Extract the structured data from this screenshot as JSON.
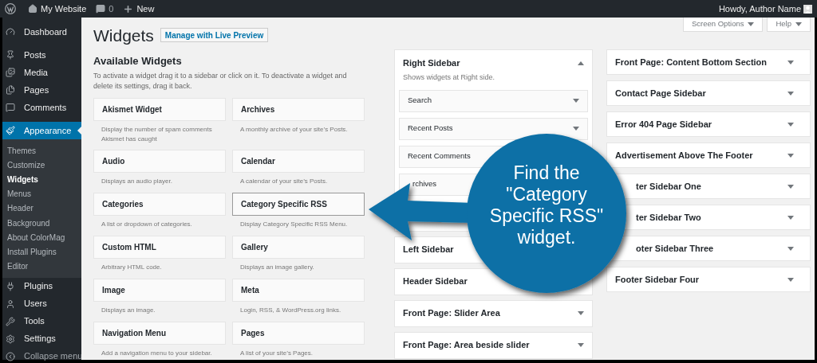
{
  "admin_bar": {
    "site_name": "My Website",
    "comments_count": "0",
    "new_label": "New",
    "greeting": "Howdy, Author Name"
  },
  "admin_menu": [
    {
      "label": "Dashboard",
      "selected": false
    },
    {
      "label": "Posts",
      "selected": false
    },
    {
      "label": "Media",
      "selected": false
    },
    {
      "label": "Pages",
      "selected": false
    },
    {
      "label": "Comments",
      "selected": false
    },
    {
      "label": "Appearance",
      "selected": true,
      "children": [
        {
          "label": "Themes",
          "selected": false
        },
        {
          "label": "Customize",
          "selected": false
        },
        {
          "label": "Widgets",
          "selected": true
        },
        {
          "label": "Menus",
          "selected": false
        },
        {
          "label": "Header",
          "selected": false
        },
        {
          "label": "Background",
          "selected": false
        },
        {
          "label": "About ColorMag",
          "selected": false
        },
        {
          "label": "Install Plugins",
          "selected": false
        },
        {
          "label": "Editor",
          "selected": false
        }
      ]
    },
    {
      "label": "Plugins",
      "selected": false
    },
    {
      "label": "Users",
      "selected": false
    },
    {
      "label": "Tools",
      "selected": false
    },
    {
      "label": "Settings",
      "selected": false
    },
    {
      "label": "Collapse menu",
      "selected": false
    }
  ],
  "page": {
    "title": "Widgets",
    "live_preview_button": "Manage with Live Preview",
    "screen_options": "Screen Options",
    "help": "Help"
  },
  "available_widgets": {
    "heading": "Available Widgets",
    "description": "To activate a widget drag it to a sidebar or click on it. To deactivate a widget and delete its settings, drag it back.",
    "widgets": [
      {
        "name": "Akismet Widget",
        "description": "Display the number of spam comments Akismet has caught",
        "highlighted": false
      },
      {
        "name": "Archives",
        "description": "A monthly archive of your site’s Posts.",
        "highlighted": false
      },
      {
        "name": "Audio",
        "description": "Displays an audio player.",
        "highlighted": false
      },
      {
        "name": "Calendar",
        "description": "A calendar of your site’s Posts.",
        "highlighted": false
      },
      {
        "name": "Categories",
        "description": "A list or dropdown of categories.",
        "highlighted": false
      },
      {
        "name": "Category Specific RSS",
        "description": "Display Category Specific RSS Menu.",
        "highlighted": true
      },
      {
        "name": "Custom HTML",
        "description": "Arbitrary HTML code.",
        "highlighted": false
      },
      {
        "name": "Gallery",
        "description": "Displays an image gallery.",
        "highlighted": false
      },
      {
        "name": "Image",
        "description": "Displays an image.",
        "highlighted": false
      },
      {
        "name": "Meta",
        "description": "Login, RSS, & WordPress.org links.",
        "highlighted": false
      },
      {
        "name": "Navigation Menu",
        "description": "Add a navigation menu to your sidebar.",
        "highlighted": false
      },
      {
        "name": "Pages",
        "description": "A list of your site’s Pages.",
        "highlighted": false
      }
    ]
  },
  "sidebars_middle": [
    {
      "title": "Right Sidebar",
      "expanded": true,
      "description": "Shows widgets at Right side.",
      "widgets": [
        {
          "name": "Search",
          "covered": false
        },
        {
          "name": "Recent Posts",
          "covered": false
        },
        {
          "name": "Recent Comments",
          "covered": false
        },
        {
          "name": "rchives",
          "covered": true
        }
      ]
    },
    {
      "title": "Left Sidebar",
      "expanded": false
    },
    {
      "title": "Header Sidebar",
      "expanded": false
    },
    {
      "title": "Front Page: Slider Area",
      "expanded": false
    },
    {
      "title": "Front Page: Area beside slider",
      "expanded": false
    }
  ],
  "sidebars_right": [
    {
      "title": "Front Page: Content Bottom Section",
      "covered": false
    },
    {
      "title": "Contact Page Sidebar",
      "covered": false
    },
    {
      "title": "Error 404 Page Sidebar",
      "covered": false
    },
    {
      "title": "Advertisement Above The Footer",
      "covered": false
    },
    {
      "title": "ter Sidebar One",
      "covered": true
    },
    {
      "title": "ter Sidebar Two",
      "covered": true
    },
    {
      "title": "oter Sidebar Three",
      "covered": true
    },
    {
      "title": "Footer Sidebar Four",
      "covered": false
    }
  ],
  "callout": {
    "text": "Find the \"Category Specific RSS\" widget."
  }
}
